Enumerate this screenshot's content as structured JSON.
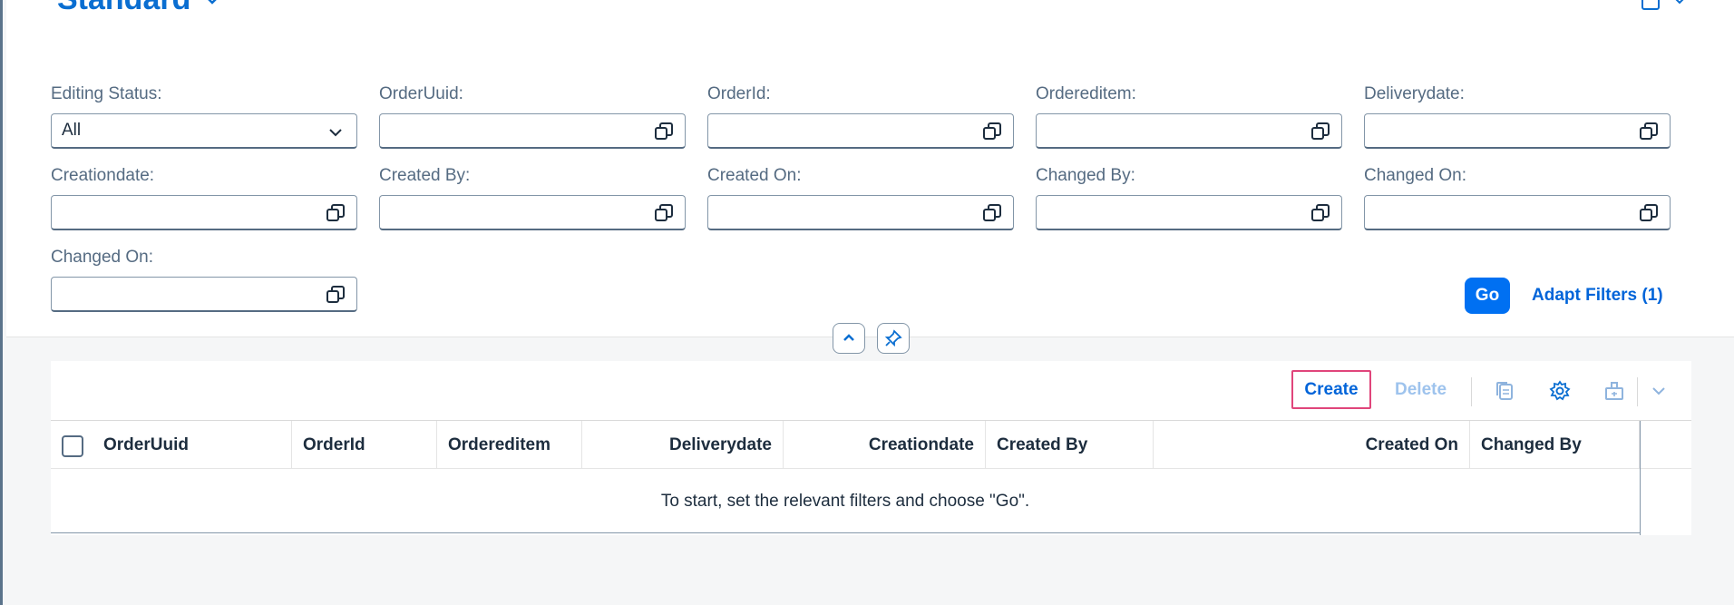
{
  "variant": {
    "title": "Standard"
  },
  "filters": [
    {
      "label": "Editing Status:",
      "value": "All",
      "type": "select"
    },
    {
      "label": "OrderUuid:",
      "value": "",
      "type": "input"
    },
    {
      "label": "OrderId:",
      "value": "",
      "type": "input"
    },
    {
      "label": "Ordereditem:",
      "value": "",
      "type": "input"
    },
    {
      "label": "Deliverydate:",
      "value": "",
      "type": "input"
    },
    {
      "label": "Creationdate:",
      "value": "",
      "type": "input"
    },
    {
      "label": "Created By:",
      "value": "",
      "type": "input"
    },
    {
      "label": "Created On:",
      "value": "",
      "type": "input"
    },
    {
      "label": "Changed By:",
      "value": "",
      "type": "input"
    },
    {
      "label": "Changed On:",
      "value": "",
      "type": "input"
    },
    {
      "label": "Changed On:",
      "value": "",
      "type": "input"
    }
  ],
  "filterbar": {
    "go_label": "Go",
    "adapt_label": "Adapt Filters (1)"
  },
  "toolbar": {
    "create_label": "Create",
    "delete_label": "Delete"
  },
  "table": {
    "columns": [
      "OrderUuid",
      "OrderId",
      "Ordereditem",
      "Deliverydate",
      "Creationdate",
      "Created By",
      "Created On",
      "Changed By"
    ],
    "nodata_text": "To start, set the relevant filters and choose \"Go\"."
  },
  "colors": {
    "accent": "#0a6ed1",
    "button": "#0070f2",
    "highlight": "#e0457b"
  }
}
